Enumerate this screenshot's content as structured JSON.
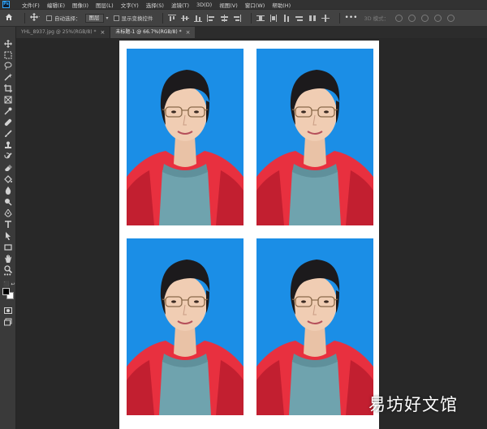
{
  "app": {
    "logo_text": "Ps",
    "menu": [
      "文件(F)",
      "编辑(E)",
      "图像(I)",
      "图层(L)",
      "文字(Y)",
      "选择(S)",
      "滤镜(T)",
      "3D(D)",
      "视图(V)",
      "窗口(W)",
      "帮助(H)"
    ]
  },
  "options_bar": {
    "auto_select_label": "自动选择：",
    "auto_select_value": "图层",
    "show_transform_label": "显示变换控件",
    "mode_3d_label": "3D 模式："
  },
  "tabs": [
    {
      "label": "YHL_8937.jpg @ 25%(RGB/8) *",
      "close": "×"
    },
    {
      "label": "未标题-1 @ 66.7%(RGB/8) *",
      "close": "×"
    }
  ],
  "tools": [
    "move-tool",
    "marquee-tool",
    "lasso-tool",
    "magic-wand-tool",
    "crop-tool",
    "frame-tool",
    "eyedropper-tool",
    "healing-brush-tool",
    "brush-tool",
    "clone-stamp-tool",
    "history-brush-tool",
    "eraser-tool",
    "paint-bucket-tool",
    "blur-tool",
    "dodge-tool",
    "pen-tool",
    "type-tool",
    "path-selection-tool",
    "rectangle-tool",
    "hand-tool",
    "zoom-tool"
  ],
  "colors": {
    "foreground": "#000000",
    "background": "#ffffff",
    "photo_bg": "#1b8ee6",
    "jacket": "#e8303f",
    "shirt": "#6fa3ae"
  },
  "watermark": "易坊好文馆"
}
